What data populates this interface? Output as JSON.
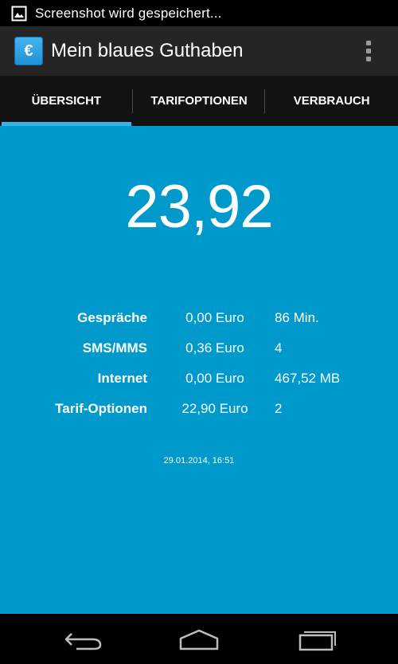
{
  "status_bar": {
    "notification_icon": "image-icon",
    "text": "Screenshot wird gespeichert..."
  },
  "action_bar": {
    "app_icon_glyph": "€",
    "title": "Mein blaues Guthaben",
    "overflow_icon": "overflow-menu-icon"
  },
  "tabs": [
    {
      "label": "ÜBERSICHT",
      "active": true
    },
    {
      "label": "TARIFOPTIONEN",
      "active": false
    },
    {
      "label": "VERBRAUCH",
      "active": false
    }
  ],
  "main": {
    "balance": "23,92",
    "rows": [
      {
        "label": "Gespräche",
        "cost": "0,00 Euro",
        "amount": "86 Min."
      },
      {
        "label": "SMS/MMS",
        "cost": "0,36 Euro",
        "amount": "4"
      },
      {
        "label": "Internet",
        "cost": "0,00 Euro",
        "amount": "467,52 MB"
      },
      {
        "label": "Tarif-Optionen",
        "cost": "22,90 Euro",
        "amount": "2"
      }
    ],
    "timestamp": "29.01.2014, 16:51"
  },
  "nav_bar": {
    "back_icon": "back-icon",
    "home_icon": "home-icon",
    "recents_icon": "recents-icon"
  },
  "colors": {
    "content_background": "#0099cc",
    "tab_indicator": "#33b5e5",
    "action_bar": "#252525",
    "tab_bar": "#121212"
  }
}
